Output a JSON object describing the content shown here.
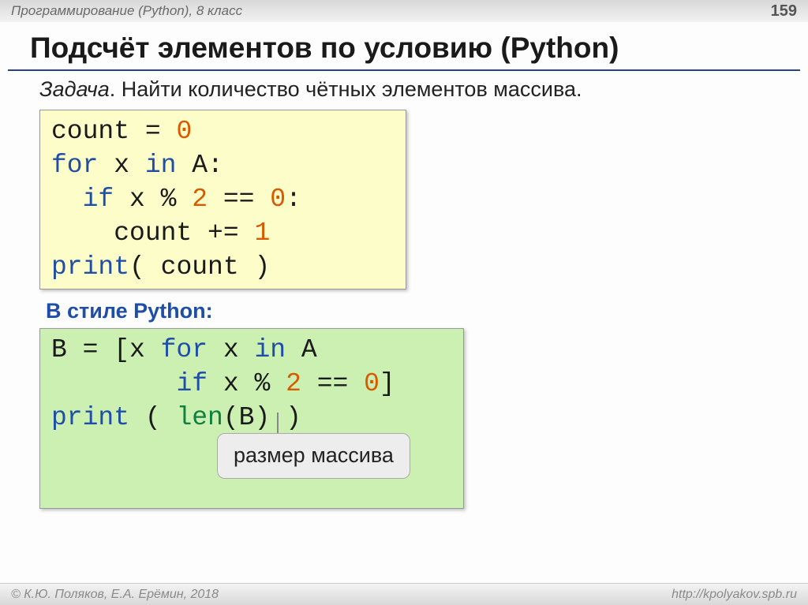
{
  "header": {
    "course": "Программирование (Python), 8 класс",
    "page_number": "159"
  },
  "title": "Подсчёт элементов по условию (Python)",
  "task": {
    "label": "Задача",
    "text": ". Найти количество чётных элементов массива."
  },
  "code1": {
    "l1a": "count = ",
    "l1b": "0",
    "l2a": "for",
    "l2b": " x ",
    "l2c": "in",
    "l2d": " A:",
    "l3a": "  ",
    "l3b": "if",
    "l3c": " x % ",
    "l3d": "2",
    "l3e": " == ",
    "l3f": "0",
    "l3g": ":",
    "l4": "    count += ",
    "l4b": "1",
    "l5a": "print",
    "l5b": "( count )"
  },
  "subhead": "В стиле Python:",
  "code2": {
    "l1a": "B = [x ",
    "l1b": "for",
    "l1c": " x ",
    "l1d": "in",
    "l1e": " A",
    "l2a": "        ",
    "l2b": "if",
    "l2c": " x % ",
    "l2d": "2",
    "l2e": " == ",
    "l2f": "0",
    "l2g": "]",
    "l3a": "print",
    "l3b": " ( ",
    "l3c": "len",
    "l3d": "(B) )"
  },
  "callout": "размер массива",
  "footer": {
    "left": "© К.Ю. Поляков, Е.А. Ерёмин, 2018",
    "right": "http://kpolyakov.spb.ru"
  }
}
